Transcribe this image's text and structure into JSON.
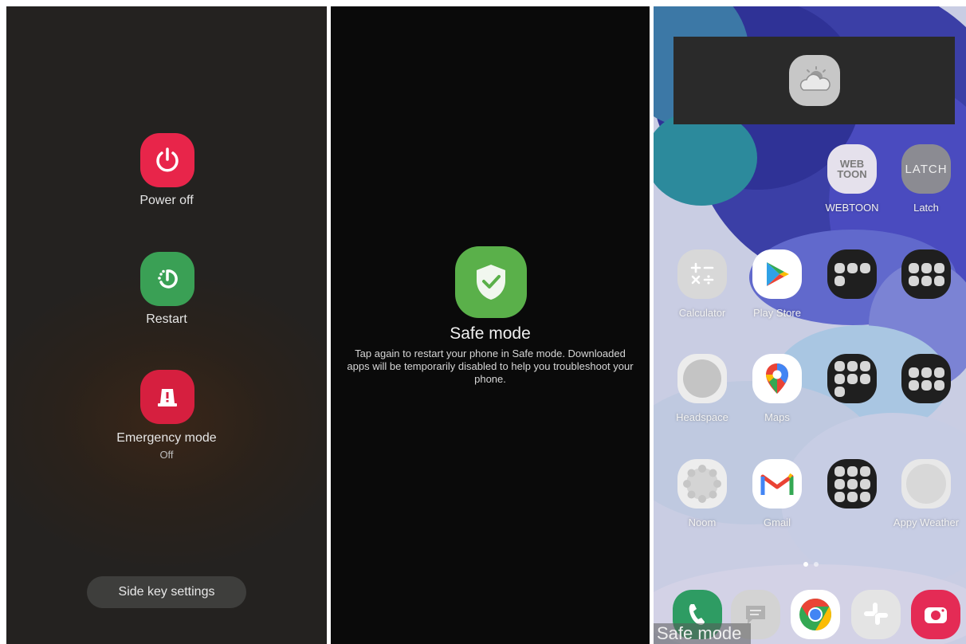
{
  "power_menu": {
    "power_off_label": "Power off",
    "restart_label": "Restart",
    "emergency_label": "Emergency mode",
    "emergency_status": "Off",
    "side_key_label": "Side key settings",
    "colors": {
      "power_off": "#e8254a",
      "restart": "#3aa055",
      "emergency": "#d61f3f"
    }
  },
  "safe_mode_prompt": {
    "title": "Safe mode",
    "description": "Tap again to restart your phone in Safe mode. Downloaded apps will be temporarily disabled to help you troubleshoot your phone.",
    "icon": "shield-check-icon",
    "color": "#5ab04a"
  },
  "home_screen": {
    "weather_widget_icon": "partly-cloudy-icon",
    "apps": {
      "webtoon": {
        "label": "WEBTOON",
        "logo_line1": "WEB",
        "logo_line2": "TOON"
      },
      "latch": {
        "label": "Latch",
        "logo": "LATCH"
      },
      "calculator": {
        "label": "Calculator"
      },
      "play_store": {
        "label": "Play Store"
      },
      "headspace": {
        "label": "Headspace"
      },
      "maps": {
        "label": "Maps"
      },
      "noom": {
        "label": "Noom"
      },
      "gmail": {
        "label": "Gmail"
      },
      "appy_weather": {
        "label": "Appy Weather"
      }
    },
    "dock": [
      "phone",
      "messages",
      "chrome",
      "slack",
      "camera"
    ],
    "safe_mode_label": "Safe mode"
  }
}
